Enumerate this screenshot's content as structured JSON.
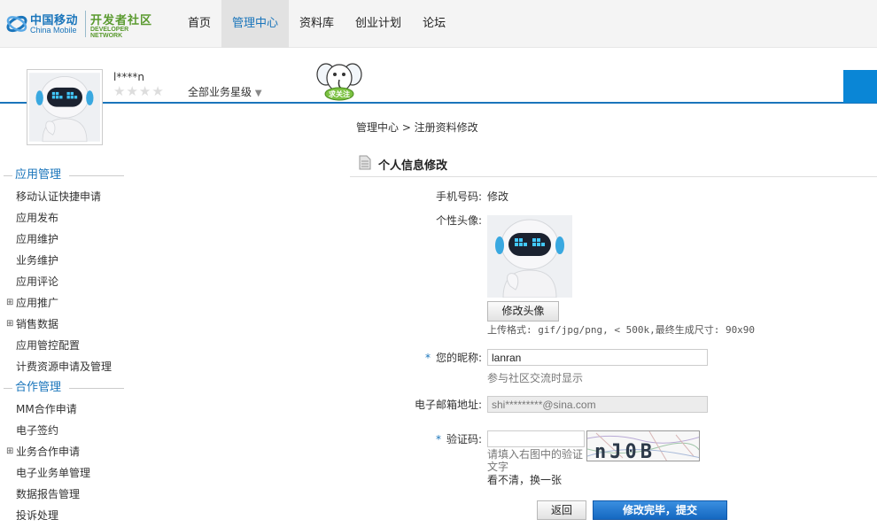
{
  "brand": {
    "cn": "中国移动",
    "en": "China Mobile",
    "dev_cn": "开发者社区",
    "dev_en": "DEVELOPER NETWORK"
  },
  "nav": {
    "items": [
      {
        "label": "首页"
      },
      {
        "label": "管理中心"
      },
      {
        "label": "资料库"
      },
      {
        "label": "创业计划"
      },
      {
        "label": "论坛"
      }
    ]
  },
  "profile": {
    "username": "l****n",
    "stars": "★★★★",
    "level_label": "全部业务星级",
    "level_caret": "▼",
    "mascot_text": "求关注"
  },
  "sidebar": {
    "sections": [
      {
        "title": "应用管理",
        "items": [
          {
            "label": "移动认证快捷申请",
            "expandable": false
          },
          {
            "label": "应用发布",
            "expandable": false
          },
          {
            "label": "应用维护",
            "expandable": false
          },
          {
            "label": "业务维护",
            "expandable": false
          },
          {
            "label": "应用评论",
            "expandable": false
          },
          {
            "label": "应用推广",
            "expandable": true
          },
          {
            "label": "销售数据",
            "expandable": true
          },
          {
            "label": "应用管控配置",
            "expandable": false
          },
          {
            "label": "计费资源申请及管理",
            "expandable": false
          }
        ]
      },
      {
        "title": "合作管理",
        "items": [
          {
            "label": "MM合作申请",
            "expandable": false
          },
          {
            "label": "电子签约",
            "expandable": false
          },
          {
            "label": "业务合作申请",
            "expandable": true
          },
          {
            "label": "电子业务单管理",
            "expandable": false
          },
          {
            "label": "数据报告管理",
            "expandable": false
          },
          {
            "label": "投诉处理",
            "expandable": false
          }
        ]
      }
    ],
    "expand_glyph": "⊞"
  },
  "breadcrumb": "管理中心 > 注册资料修改",
  "section_title": "个人信息修改",
  "form": {
    "phone_label": "手机号码:",
    "phone_value": "修改",
    "avatar_label": "个性头像:",
    "change_avatar_button": "修改头像",
    "upload_hint": "上传格式: gif/jpg/png, < 500k,最终生成尺寸: 90x90",
    "required_mark": "*",
    "nickname_label": "您的昵称:",
    "nickname_value": "lanran",
    "nickname_hint": "参与社区交流时显示",
    "email_label": "电子邮箱地址:",
    "email_value": "shi*********@sina.com",
    "captcha_label": "验证码:",
    "captcha_value": "",
    "captcha_hint": "请填入右图中的验证文字",
    "captcha_text": "nJ0B",
    "captcha_refresh": "看不清，换一张",
    "back_button": "返回",
    "submit_button": "修改完毕，提交"
  },
  "colors": {
    "accent": "#1a75bb",
    "brand_green": "#5a9a2f",
    "submit": "#1568c1"
  }
}
